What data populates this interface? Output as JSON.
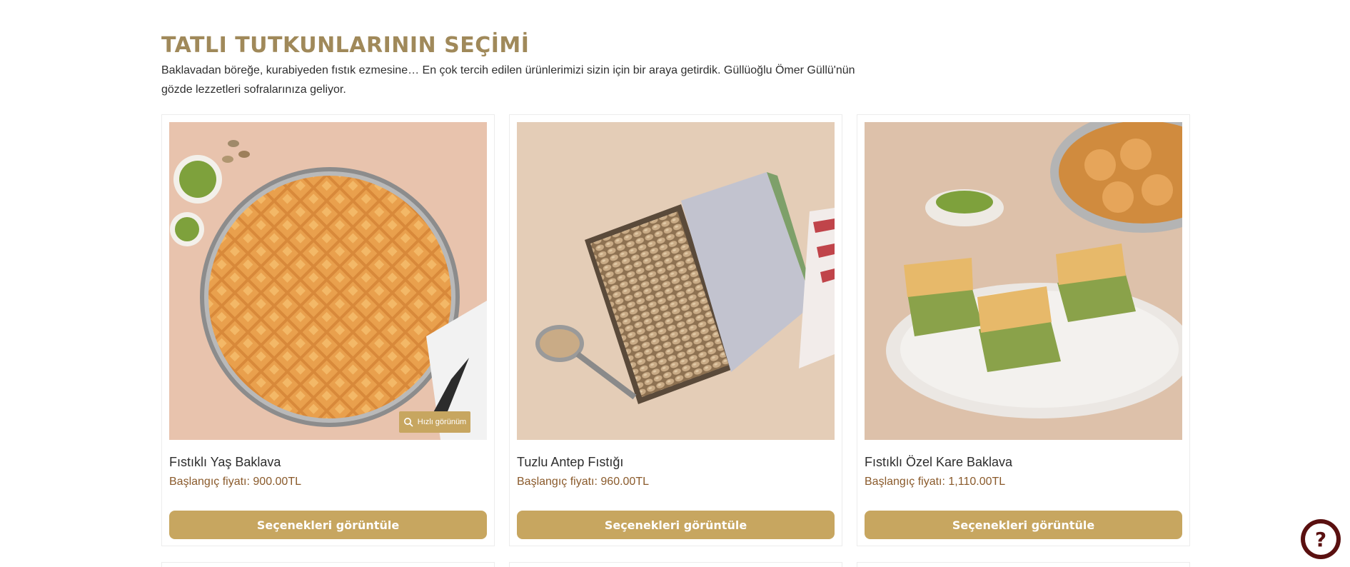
{
  "section": {
    "title": "TATLI TUTKUNLARININ SEÇİMİ",
    "description": "Baklavadan böreğe, kurabiyeden fıstık ezmesine… En çok tercih edilen ürünlerimizi sizin için bir araya getirdik. Güllüoğlu Ömer Güllü'nün gözde lezzetleri sofralarınıza geliyor."
  },
  "products": [
    {
      "name": "Fıstıklı Yaş Baklava",
      "price": "Başlangıç fiyatı: 900.00TL",
      "button": "Seçenekleri görüntüle",
      "quick_view": "Hızlı görünüm",
      "image": "baklava-tray-photo"
    },
    {
      "name": "Tuzlu Antep Fıstığı",
      "price": "Başlangıç fiyatı: 960.00TL",
      "button": "Seçenekleri görüntüle",
      "image": "pistachio-box-photo"
    },
    {
      "name": "Fıstıklı Özel Kare Baklava",
      "price": "Başlangıç fiyatı: 1,110.00TL",
      "button": "Seçenekleri görüntüle",
      "image": "square-baklava-plate-photo"
    }
  ],
  "help_button": {
    "icon": "question-icon",
    "label": "?"
  },
  "colors": {
    "title": "#a0895a",
    "button": "#c7a660",
    "price": "#8a5a2b",
    "help": "#5a1010"
  }
}
